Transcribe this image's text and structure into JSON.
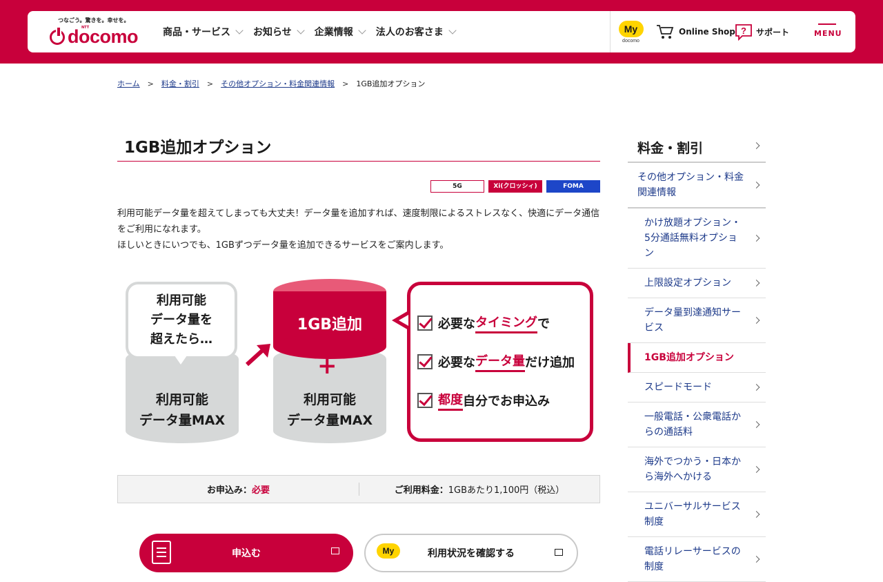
{
  "header": {
    "tagline": "つなごう。驚きを。幸せを。",
    "logo_text": "docomo",
    "logo_sup": "NTT",
    "nav": [
      {
        "label": "商品・サービス"
      },
      {
        "label": "お知らせ"
      },
      {
        "label": "企業情報"
      },
      {
        "label": "法人のお客さま"
      }
    ],
    "my_badge": "My",
    "my_sub": "docomo",
    "online_shop": "Online Shop",
    "support": "サポート",
    "menu": "MENU"
  },
  "breadcrumb": [
    "ホーム",
    "料金・割引",
    "その他オプション・料金関連情報",
    "1GB追加オプション"
  ],
  "breadcrumb_sep": ">",
  "page_title": "1GB追加オプション",
  "tags": [
    "5G",
    "Xi(クロッシィ)",
    "FOMA"
  ],
  "intro": [
    "利用可能データ量を超えてしまっても大丈夫！データ量を追加すれば、速度制限によるストレスなく、快適にデータ通信をご利用になれます。",
    "ほしいときにいつでも、1GBずつデータ量を追加できるサービスをご案内します。"
  ],
  "illustration": {
    "bubble": [
      "利用可能",
      "データ量を",
      "超えたら…"
    ],
    "cyl_left": [
      "利用可能",
      "データ量MAX"
    ],
    "cyl_add": "1GB追加",
    "cyl_right": [
      "利用可能",
      "データ量MAX"
    ],
    "features": [
      {
        "pre": "必要な",
        "em": "タイミング",
        "post": "で"
      },
      {
        "pre": "必要な",
        "em": "データ量",
        "post": "だけ追加"
      },
      {
        "pre": "",
        "em": "都度",
        "post": "自分でお申込み"
      }
    ]
  },
  "info": {
    "apply_label": "お申込み：",
    "apply_value": "必要",
    "fee_label": "ご利用料金：",
    "fee_value": "1GBあたり1,100円（税込）"
  },
  "buttons": {
    "apply": "申込む",
    "usage": "利用状況を確認する",
    "usage_badge": "My"
  },
  "sidebar": {
    "heading": "料金・割引",
    "sub": "その他オプション・料金関連情報",
    "items": [
      "かけ放題オプション・5分通話無料オプション",
      "上限設定オプション",
      "データ量到達通知サービス",
      "1GB追加オプション",
      "スピードモード",
      "一般電話・公衆電話からの通話料",
      "海外でつかう・日本から海外へかける",
      "ユニバーサルサービス制度",
      "電話リレーサービスの制度"
    ],
    "active_index": 3
  },
  "colors": {
    "brand": "#c8003b",
    "foma": "#1d46c8",
    "my_yellow": "#ffd400"
  }
}
